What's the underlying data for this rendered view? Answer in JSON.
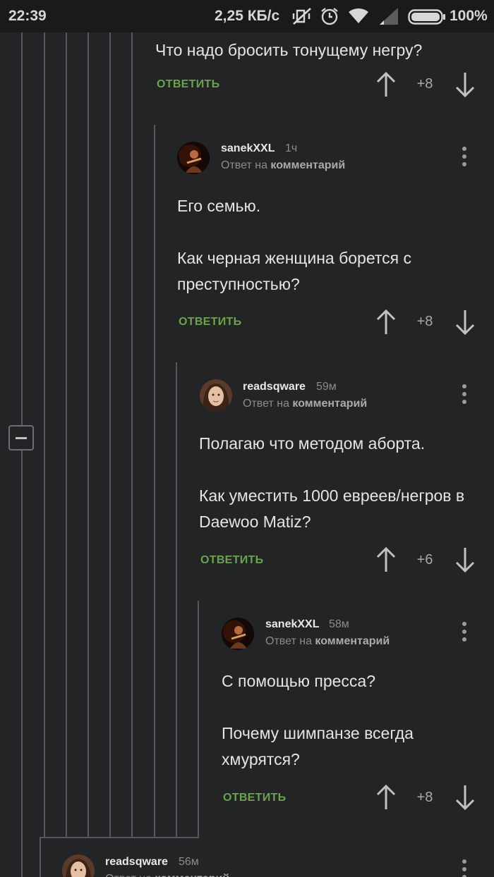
{
  "status_bar": {
    "time": "22:39",
    "network_speed": "2,25 КБ/с",
    "battery": "100%",
    "icons": [
      "mute-vibrate-icon",
      "alarm-icon",
      "wifi-icon",
      "signal-icon",
      "battery-icon"
    ]
  },
  "colors": {
    "background": "#222426",
    "reply_green": "#6aa34a",
    "thread_line": "#55585b"
  },
  "reply_label": "ОТВЕТИТЬ",
  "reply_to_prefix": "Ответ на",
  "reply_to_target": "комментарий",
  "comments": [
    {
      "text": "Что надо бросить тонущему негру?",
      "rating": "+8"
    },
    {
      "author": "sanekXXL",
      "time": "1ч",
      "text": "Его семью.\n\nКак черная женщина борется с преступностью?",
      "rating": "+8"
    },
    {
      "author": "readsqware",
      "time": "59м",
      "text": "Полагаю что методом аборта.\n\nКак уместить 1000 евреев/негров в Daewoo Matiz?",
      "rating": "+6"
    },
    {
      "author": "sanekXXL",
      "time": "58м",
      "text": "С помощью пресса?\n\nПочему шимпанзе всегда хмурятся?",
      "rating": "+8"
    },
    {
      "author": "readsqware",
      "time": "56м"
    }
  ]
}
